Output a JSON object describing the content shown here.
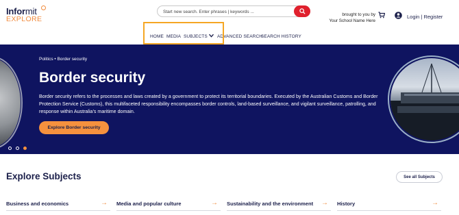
{
  "header": {
    "logo_top_bold": "Infor",
    "logo_top_light": "mit",
    "logo_bottom": "EXPLORE",
    "search_placeholder": "Start new search. Enter phrases | keywords ...",
    "brought_line1": "brought to you by",
    "brought_line2": "Your School Name Here",
    "login": "Login | Register"
  },
  "nav": {
    "items": [
      "HOME",
      "MEDIA",
      "SUBJECTS",
      "ADVANCED SEARCH",
      "SEARCH HISTORY"
    ]
  },
  "hero": {
    "breadcrumb": "Politics  •  Border security",
    "title": "Border security",
    "description": "Border security refers to the processes and laws created by a government to protect its territorial boundaries. Executed by the Australian Customs and Border Protection Service (Customs), this multifaceted responsibility encompasses border controls, land-based surveillance, and vigilant surveillance, patrolling, and response within Australia’s maritime domain.",
    "button": "Explore Border security",
    "slides": 3,
    "active_slide": 3
  },
  "explore": {
    "title": "Explore Subjects",
    "see_all": "See all Subjects",
    "subjects": [
      {
        "label": "Business and economics"
      },
      {
        "label": "Media and popular culture"
      },
      {
        "label": "Sustainability and the environment"
      },
      {
        "label": "History"
      }
    ]
  },
  "colors": {
    "brand_navy": "#0f1460",
    "accent_orange": "#f5913e",
    "search_red": "#e0202d",
    "highlight_box": "#f5a623"
  },
  "icons": [
    "search-icon",
    "cart-icon",
    "user-icon",
    "chevron-down-icon",
    "arrow-right-icon"
  ]
}
